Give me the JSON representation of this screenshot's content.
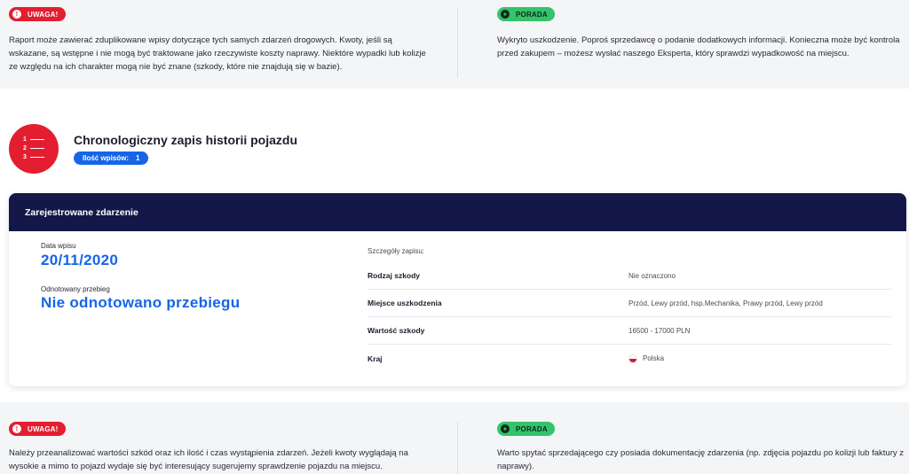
{
  "top_notes": {
    "warning_badge": "UWAGA!",
    "warning_text": "Raport może zawierać zduplikowane wpisy dotyczące tych samych zdarzeń drogowych. Kwoty, jeśli są wskazane, są wstępne i nie mogą być traktowane jako rzeczywiste koszty naprawy. Niektóre wypadki lub kolizje ze względu na ich charakter mogą nie być znane (szkody, które nie znajdują się w bazie).",
    "tip_badge": "PORADA",
    "tip_text": "Wykryto uszkodzenie. Poproś sprzedawcę o podanie dodatkowych informacji. Konieczna może być kontrola przed zakupem – możesz wysłać naszego Eksperta, który sprawdzi wypadkowość na miejscu."
  },
  "history": {
    "icon_numbers": [
      "1",
      "2",
      "3"
    ],
    "title": "Chronologiczny zapis historii pojazdu",
    "count_label": "Ilość wpisów:",
    "count_value": "1"
  },
  "event": {
    "header": "Zarejestrowane zdarzenie",
    "date_label": "Data wpisu",
    "date_value": "20/11/2020",
    "mileage_label": "Odnotowany przebieg",
    "mileage_value": "Nie odnotowano przebiegu",
    "details_label": "Szczegóły zapisu:",
    "details": [
      {
        "key": "Rodzaj szkody",
        "value": "Nie oznaczono"
      },
      {
        "key": "Miejsce uszkodzenia",
        "value": "Przód, Lewy przód, hsp.Mechanika, Prawy przód, Lewy przód"
      },
      {
        "key": "Wartość szkody",
        "value": "16500 - 17000 PLN"
      },
      {
        "key": "Kraj",
        "value": "Polska"
      }
    ]
  },
  "bottom_notes": {
    "warning_badge": "UWAGA!",
    "warning_text": "Należy przeanalizować wartości szkód oraz ich ilość i czas wystąpienia zdarzeń. Jeżeli kwoty wyglądają na wysokie a mimo to pojazd wydaje się być interesujący sugerujemy sprawdzenie pojazdu na miejscu.",
    "tip_badge": "PORADA",
    "tip_text": "Warto spytać sprzedającego czy posiada dokumentację zdarzenia (np. zdjęcia pojazdu po kolizji lub faktury z naprawy)."
  },
  "colors": {
    "warning": "#e31e30",
    "tip": "#34c36b",
    "accent_blue": "#1565e8",
    "card_header": "#141848"
  }
}
